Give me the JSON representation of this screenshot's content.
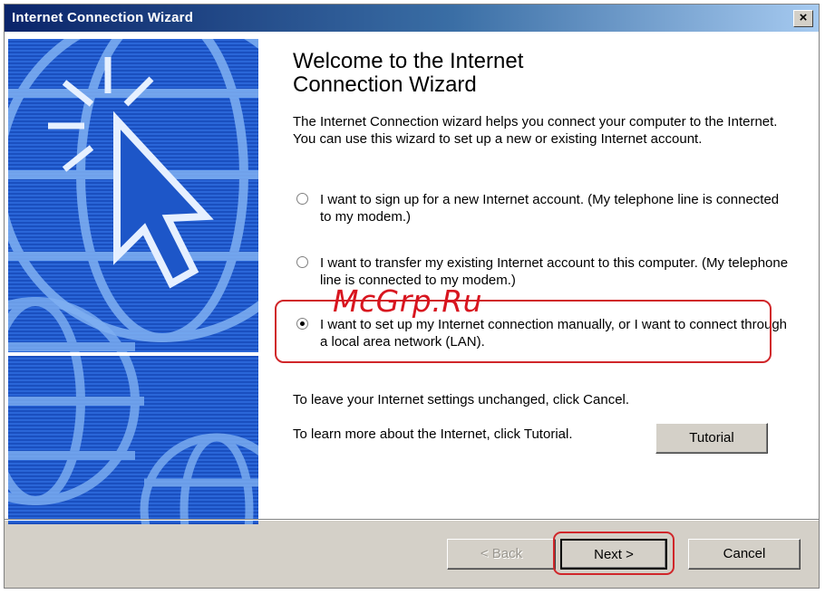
{
  "window": {
    "title": "Internet Connection Wizard",
    "close_label": "×"
  },
  "heading": "Welcome to the Internet\nConnection Wizard",
  "intro": "The Internet Connection wizard helps you connect your computer to the Internet.  You can use this wizard to set up a new or existing Internet account.",
  "options": [
    {
      "label": "I want to sign up for a new Internet account. (My telephone line is connected to my modem.)",
      "selected": false
    },
    {
      "label": "I want to transfer my existing Internet account to this computer. (My telephone line is connected to my modem.)",
      "selected": false
    },
    {
      "label": "I want to set up my Internet connection manually, or I want to connect through a local area network (LAN).",
      "selected": true
    }
  ],
  "watermark": "McGrp.Ru",
  "notes": {
    "cancel_note": "To leave your Internet settings unchanged, click Cancel.",
    "tutorial_note": "To learn more about the Internet, click Tutorial."
  },
  "buttons": {
    "tutorial": "Tutorial",
    "back": "< Back",
    "next": "Next >",
    "cancel": "Cancel"
  },
  "colors": {
    "title_bar": "#0a246a",
    "banner": "#1d56c8",
    "highlight": "#d0262a"
  }
}
